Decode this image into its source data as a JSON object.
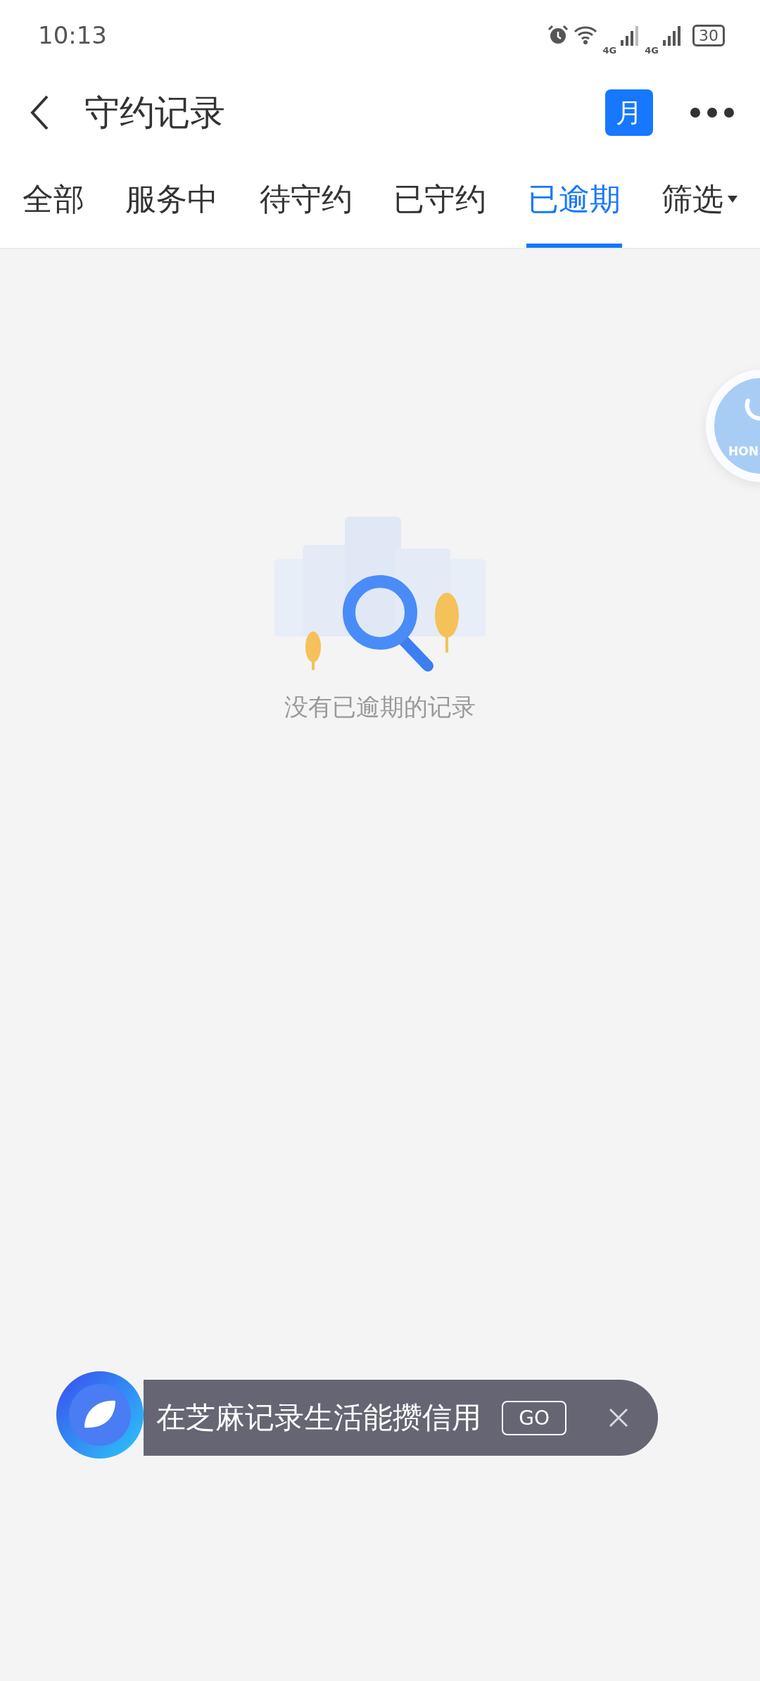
{
  "status_bar": {
    "time": "10:13",
    "network_1": "4G",
    "network_2": "4G",
    "battery": "30"
  },
  "header": {
    "title": "守约记录",
    "calendar_label": "月"
  },
  "tabs": [
    {
      "label": "全部",
      "selected": false
    },
    {
      "label": "服务中",
      "selected": false
    },
    {
      "label": "待守约",
      "selected": false
    },
    {
      "label": "已守约",
      "selected": false
    },
    {
      "label": "已逾期",
      "selected": true
    }
  ],
  "filter": {
    "label": "筛选"
  },
  "empty_state": {
    "message": "没有已逾期的记录"
  },
  "floating_button": {
    "label": "HON"
  },
  "banner": {
    "text": "在芝麻记录生活能攒信用",
    "button": "GO"
  }
}
